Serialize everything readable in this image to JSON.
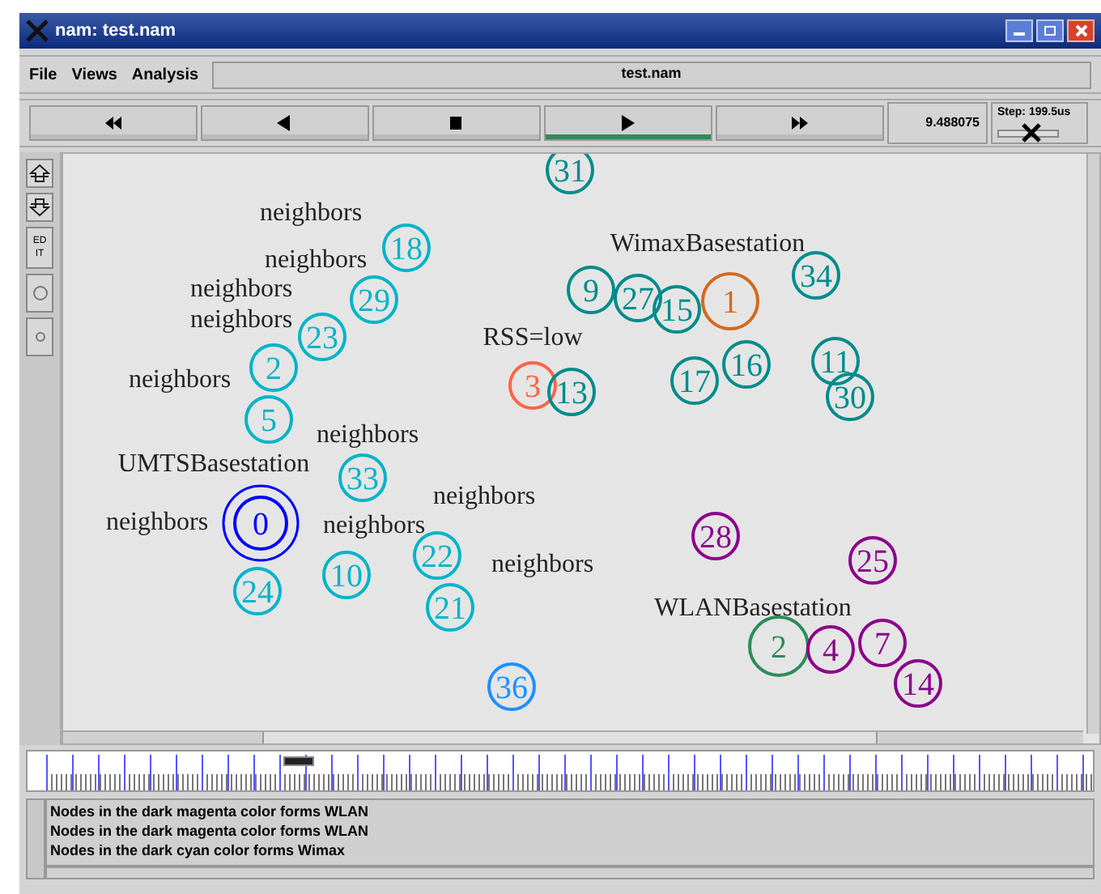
{
  "window": {
    "title": "nam: test.nam"
  },
  "menu": [
    "File",
    "Views",
    "Analysis"
  ],
  "file_field": "test.nam",
  "playback": [
    {
      "kind": "rewind",
      "selected": false
    },
    {
      "kind": "back",
      "selected": false
    },
    {
      "kind": "stop",
      "selected": false
    },
    {
      "kind": "play",
      "selected": true
    },
    {
      "kind": "forward",
      "selected": false
    }
  ],
  "time": "9.488075",
  "step": {
    "label": "Step: 199.5us",
    "level": 0.55
  },
  "side_tools": [
    {
      "kind": "zoom-in"
    },
    {
      "kind": "zoom-out"
    },
    {
      "kind": "text",
      "label": "EDIT"
    },
    {
      "kind": "big-dot"
    },
    {
      "kind": "small-dot"
    }
  ],
  "canvas": {
    "nodes": [
      {
        "label": "31",
        "color": "#008b8b",
        "kind": "single"
      },
      {
        "label": "18",
        "color": "#00b4c8",
        "kind": "single"
      },
      {
        "label": "29",
        "color": "#00b4c8",
        "kind": "single"
      },
      {
        "label": "2",
        "color": "#00b4c8",
        "kind": "single"
      },
      {
        "label": "23",
        "color": "#00b4c8",
        "kind": "single"
      },
      {
        "label": "5",
        "color": "#00b4c8",
        "kind": "single"
      },
      {
        "label": "33",
        "color": "#00b4c8",
        "kind": "single"
      },
      {
        "label": "0",
        "color": "#0000ff",
        "kind": "double"
      },
      {
        "label": "24",
        "color": "#00b4c8",
        "kind": "single"
      },
      {
        "label": "10",
        "color": "#00b4c8",
        "kind": "single"
      },
      {
        "label": "22",
        "color": "#00b4c8",
        "kind": "single"
      },
      {
        "label": "21",
        "color": "#00b4c8",
        "kind": "single"
      },
      {
        "label": "36",
        "color": "#1e90ff",
        "kind": "single"
      },
      {
        "label": "3",
        "color": "#ff6347",
        "kind": "single"
      },
      {
        "label": "13",
        "color": "#008b8b",
        "kind": "single"
      },
      {
        "label": "9",
        "color": "#008b8b",
        "kind": "single"
      },
      {
        "label": "27",
        "color": "#008b8b",
        "kind": "single"
      },
      {
        "label": "15",
        "color": "#008b8b",
        "kind": "single"
      },
      {
        "label": "1",
        "color": "#d2691e",
        "kind": "single"
      },
      {
        "label": "34",
        "color": "#008b8b",
        "kind": "single"
      },
      {
        "label": "16",
        "color": "#008b8b",
        "kind": "single"
      },
      {
        "label": "17",
        "color": "#008b8b",
        "kind": "single"
      },
      {
        "label": "11",
        "color": "#008b8b",
        "kind": "single"
      },
      {
        "label": "30",
        "color": "#008b8b",
        "kind": "single"
      },
      {
        "label": "28",
        "color": "#8b008b",
        "kind": "single"
      },
      {
        "label": "25",
        "color": "#8b008b",
        "kind": "single"
      },
      {
        "label": "2",
        "color": "#2e8b57",
        "kind": "big"
      },
      {
        "label": "4",
        "color": "#8b008b",
        "kind": "single"
      },
      {
        "label": "7",
        "color": "#8b008b",
        "kind": "single"
      },
      {
        "label": "14",
        "color": "#8b008b",
        "kind": "single"
      }
    ],
    "labels": [
      "neighbors",
      "neighbors",
      "neighbors",
      "neighbors",
      "neighbors",
      "RSS=low",
      "WimaxBasestation",
      "UMTSBasestation",
      "neighbors",
      "neighbors",
      "neighbors",
      "neighbors",
      "neighbors",
      "WLANBasestation"
    ]
  },
  "log": [
    "Nodes in the dark magenta color forms WLAN",
    "Nodes in the dark magenta color forms WLAN",
    "Nodes in the dark cyan color forms Wimax"
  ]
}
